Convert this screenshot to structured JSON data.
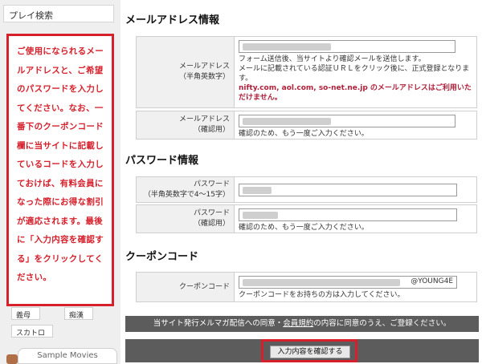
{
  "sidebar": {
    "play_search": "プレイ検索",
    "notice": "ご使用になられるメールアドレスと、ご希望のパスワードを入力してください。なお、一番下のクーポンコード欄に当サイトに記載しているコードを入力しておけば、有料会員になった際にお得な割引が適応されます。最後に「入力内容を確認する」をクリックしてください。",
    "tags": [
      "義母",
      "痴漢",
      "スカトロ"
    ],
    "sample_movies": "Sample Movies"
  },
  "email": {
    "title": "メールアドレス情報",
    "label_line1": "メールアドレス",
    "label_line2": "（半角英数字）",
    "desc_1": "フォーム送信後、当サイトより確認メールを送信します。",
    "desc_2": "メールに記載されている認証ＵＲＬをクリック後に、正式登録となります。",
    "warning": "nifty.com, aol.com, so-net.ne.jp のメールアドレスはご利用いただけません。",
    "confirm_label_line1": "メールアドレス",
    "confirm_label_line2": "（確認用）",
    "confirm_desc": "確認のため、もう一度ご入力ください。"
  },
  "password": {
    "title": "パスワード情報",
    "label_line1": "パスワード",
    "label_line2": "（半角英数字で4～15字）",
    "confirm_label_line1": "パスワード",
    "confirm_label_line2": "（確認用）",
    "confirm_desc": "確認のため、もう一度ご入力ください。"
  },
  "coupon": {
    "title": "クーポンコード",
    "label": "クーポンコード",
    "value_suffix": "@YOUNG4E",
    "desc": "クーポンコードをお持ちの方は入力してください。"
  },
  "agreement": {
    "prefix": "当サイト発行メルマガ配信への同意・",
    "link": "会員規約",
    "suffix": "の内容に同意のうえ、ご登録ください。"
  },
  "confirm_button": "入力内容を確認する"
}
